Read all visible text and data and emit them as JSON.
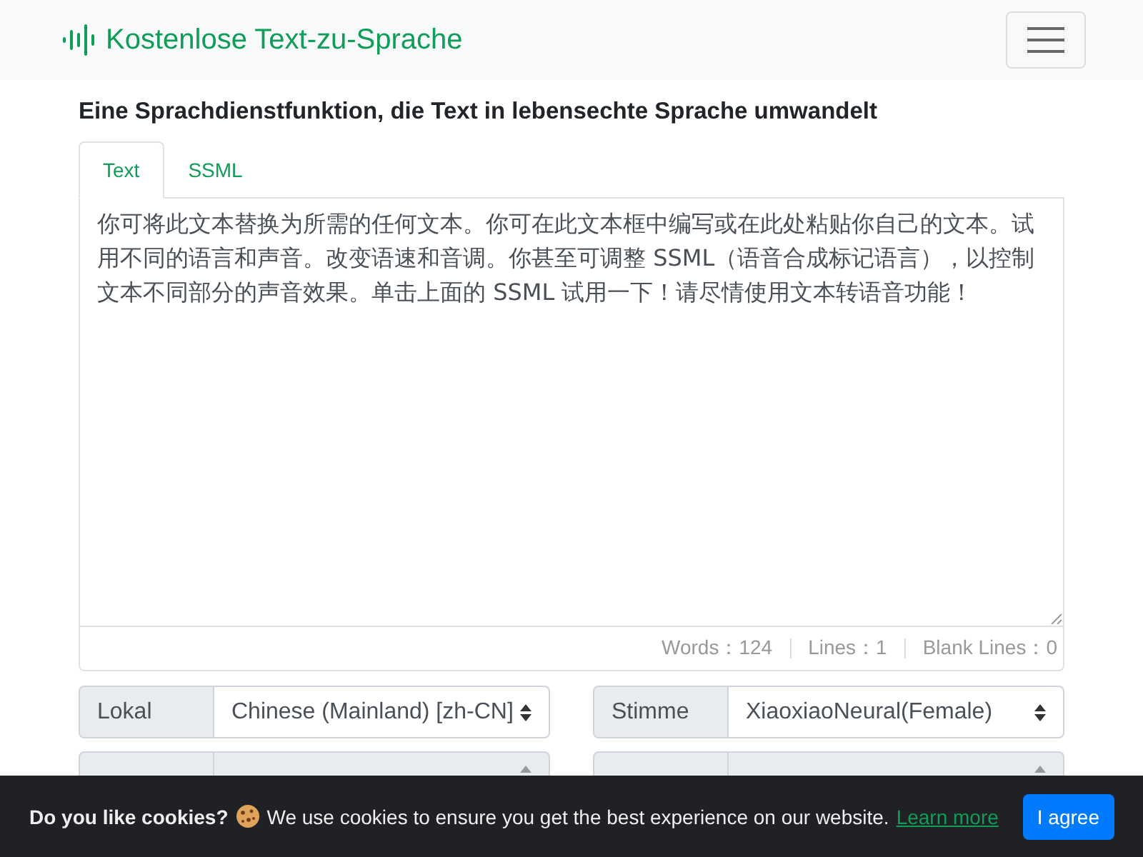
{
  "navbar": {
    "brand": "Kostenlose Text-zu-Sprache"
  },
  "heading": "Eine Sprachdienstfunktion, die Text in lebensechte Sprache umwandelt",
  "tabs": [
    {
      "label": "Text",
      "selected": true
    },
    {
      "label": "SSML",
      "selected": false
    }
  ],
  "editor": {
    "value": "你可将此文本替换为所需的任何文本。你可在此文本框中编写或在此处粘贴你自己的文本。试用不同的语言和声音。改变语速和音调。你甚至可调整 SSML（语音合成标记语言），以控制文本不同部分的声音效果。单击上面的 SSML 试用一下！请尽情使用文本转语音功能！",
    "stats": [
      "Words：124",
      "Lines：1",
      "Blank Lines：0"
    ]
  },
  "settings": [
    {
      "label": "Lokal",
      "value": "Chinese (Mainland) [zh-CN]",
      "disabled": false
    },
    {
      "label": "Stimme",
      "value": "XiaoxiaoNeural(Female)",
      "disabled": false
    },
    {
      "disabled": true
    },
    {
      "disabled": true
    }
  ],
  "cookie_banner": {
    "title": "Do you like cookies?",
    "message": "We use cookies to ensure you get the best experience on our website.",
    "link": "Learn more",
    "button": "I agree"
  }
}
